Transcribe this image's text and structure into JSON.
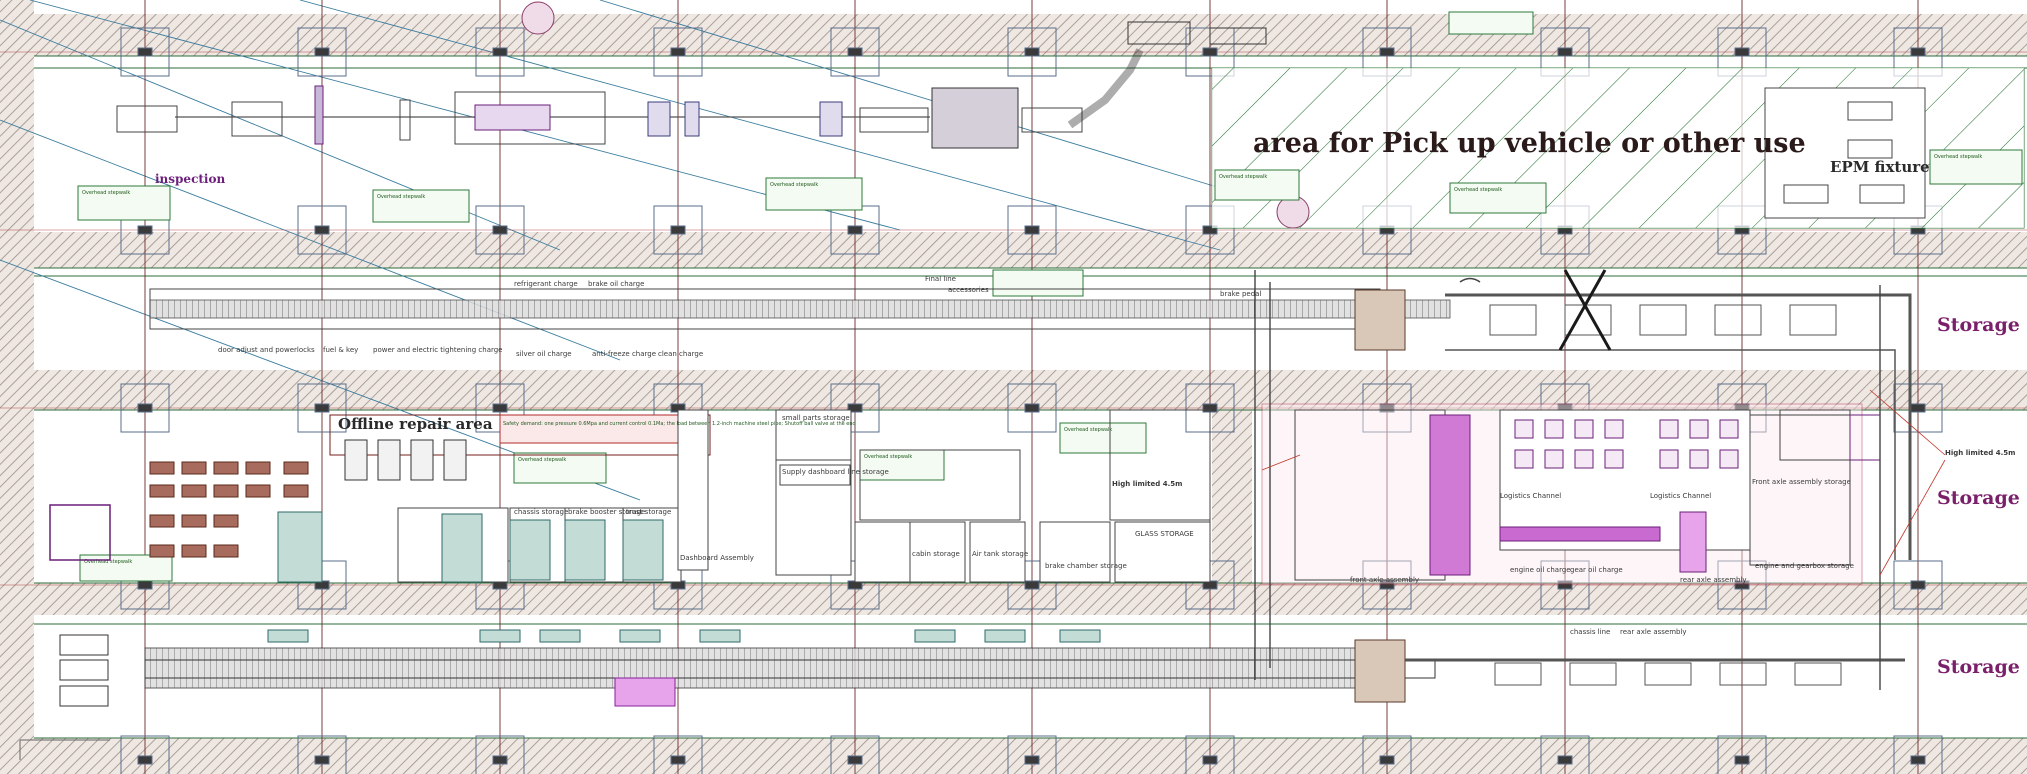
{
  "drawing": {
    "pickup_area_label": "area for Pick up vehicle or other use",
    "epm_fixture_label": "EPM fixture",
    "storage_labels": [
      "Storage",
      "Storage",
      "Storage"
    ],
    "offline_repair_label": "Offline repair area",
    "inspection_label": "inspection",
    "high_limit_labels": [
      "High limited 4.5m",
      "High limited 4.5m"
    ],
    "legend_box_text": "Overhead stepwalk",
    "row2_labels": [
      "door adjust and powerlocks",
      "fuel & key",
      "power and electric tightening charge",
      "silver oil charge",
      "anti-freeze charge",
      "clean charge",
      "refrigerant charge",
      "brake oil charge",
      "Final line",
      "accessories",
      "brake pedal"
    ],
    "lower_area_labels": [
      "Logistics Channel",
      "Logistics Channel",
      "engine oil charge",
      "gear oil charge",
      "front axle assembly",
      "rear axle assembly",
      "engine and gearbox storage",
      "Front axle assembly storage",
      "chassis line",
      "rear axle assembly"
    ],
    "storage_room_labels": [
      "chassis storage",
      "brake booster storage",
      "trust storage",
      "cabin storage",
      "Air tank storage",
      "brake chamber storage",
      "GLASS STORAGE",
      "Dashboard Assembly",
      "Supply dashboard line storage",
      "small parts storage"
    ],
    "repair_note": "Safety demand: one pressure 0.6Mpa and current control 0.1Ma; the load between 1.2-inch machine steel pipe; Shutoff ball valve at the end"
  }
}
